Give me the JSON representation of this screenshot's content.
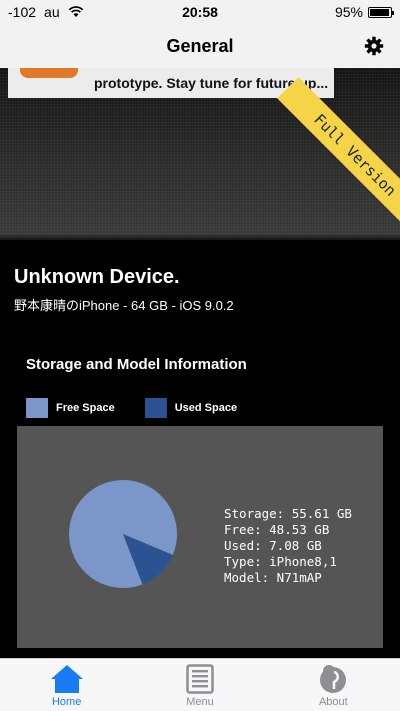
{
  "status_bar": {
    "signal": "-102",
    "carrier": "au",
    "time": "20:58",
    "battery": "95%",
    "battery_level": 0.95
  },
  "nav": {
    "title": "General"
  },
  "hero": {
    "notice_text": "prototype. Stay tune for future up...",
    "ribbon_text": "Full Version"
  },
  "device": {
    "name": "Unknown Device.",
    "subtitle": "野本康晴のiPhone - 64 GB - iOS 9.0.2"
  },
  "storage_card": {
    "title": "Storage and Model Information",
    "legend": [
      {
        "label": "Free Space",
        "color": "#7b96c8"
      },
      {
        "label": "Used Space",
        "color": "#2c5391"
      }
    ],
    "stats": {
      "storage": "Storage: 55.61 GB",
      "free": "Free: 48.53 GB",
      "used": "Used: 7.08 GB",
      "type": "Type: iPhone8,1",
      "model": "Model: N71mAP"
    }
  },
  "chart_data": {
    "type": "pie",
    "labels": [
      "Free Space",
      "Used Space"
    ],
    "values": [
      48.53,
      7.08
    ],
    "colors": [
      "#7b96c8",
      "#2c5391"
    ]
  },
  "tabbar": {
    "tabs": [
      {
        "label": "Home",
        "icon": "home-icon",
        "active": true
      },
      {
        "label": "Menu",
        "icon": "menu-icon",
        "active": false
      },
      {
        "label": "About",
        "icon": "about-icon",
        "active": false
      }
    ]
  }
}
